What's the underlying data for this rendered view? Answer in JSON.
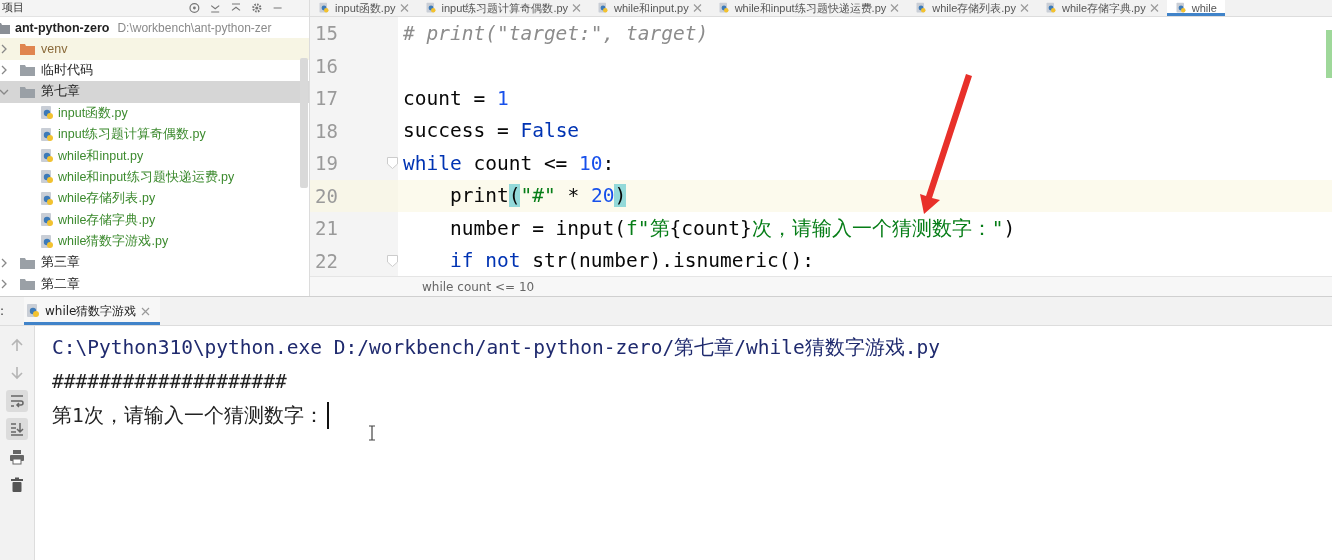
{
  "sidebar": {
    "title": "项目",
    "tree": [
      {
        "name": "ant-python-zero",
        "path": "D:\\workbench\\ant-python-zer",
        "kind": "root",
        "selected": false,
        "children": [
          {
            "name": "venv",
            "kind": "excluded",
            "expanded": false,
            "selected": false
          },
          {
            "name": "临时代码",
            "kind": "folder",
            "expanded": false,
            "selected": false
          },
          {
            "name": "第七章",
            "kind": "folder",
            "expanded": true,
            "selected": true,
            "children": [
              {
                "name": "input函数.py",
                "kind": "file",
                "selected": false
              },
              {
                "name": "input练习题计算奇偶数.py",
                "kind": "file",
                "selected": false
              },
              {
                "name": "while和input.py",
                "kind": "file",
                "selected": false
              },
              {
                "name": "while和input练习题快递运费.py",
                "kind": "file",
                "selected": false
              },
              {
                "name": "while存储列表.py",
                "kind": "file",
                "selected": false
              },
              {
                "name": "while存储字典.py",
                "kind": "file",
                "selected": false
              },
              {
                "name": "while猜数字游戏.py",
                "kind": "file",
                "selected": false
              }
            ]
          },
          {
            "name": "第三章",
            "kind": "folder",
            "expanded": false,
            "selected": false
          },
          {
            "name": "第二章",
            "kind": "folder",
            "expanded": false,
            "selected": false
          }
        ]
      }
    ]
  },
  "editor": {
    "tabs": [
      {
        "label": "input函数.py",
        "selected": false
      },
      {
        "label": "input练习题计算奇偶数.py",
        "selected": false
      },
      {
        "label": "while和input.py",
        "selected": false
      },
      {
        "label": "while和input练习题快递运费.py",
        "selected": false
      },
      {
        "label": "while存储列表.py",
        "selected": false
      },
      {
        "label": "while存储字典.py",
        "selected": false
      },
      {
        "label": "while",
        "selected": true
      }
    ],
    "lines": [
      {
        "number": "15",
        "current": false,
        "foldable": false,
        "tokens": [
          {
            "kind": "comment",
            "text": "# print(\"target:\", target)"
          }
        ]
      },
      {
        "number": "16",
        "current": false,
        "foldable": false
      },
      {
        "number": "17",
        "current": false,
        "foldable": false,
        "tokens": [
          {
            "kind": "plain",
            "text": "count = "
          },
          {
            "kind": "number",
            "text": "1"
          }
        ]
      },
      {
        "number": "18",
        "current": false,
        "foldable": false,
        "tokens": [
          {
            "kind": "plain",
            "text": "success = "
          },
          {
            "kind": "keyword",
            "text": "False"
          }
        ]
      },
      {
        "number": "19",
        "current": false,
        "foldable": true,
        "tokens": [
          {
            "kind": "keyword",
            "text": "while"
          },
          {
            "kind": "plain",
            "text": " count <= "
          },
          {
            "kind": "number",
            "text": "10"
          },
          {
            "kind": "plain",
            "text": ":"
          }
        ]
      },
      {
        "number": "20",
        "current": true,
        "foldable": false,
        "tokens": [
          {
            "kind": "plain",
            "text": "    print"
          },
          {
            "kind": "brace",
            "text": "("
          },
          {
            "kind": "string",
            "text": "\"#\""
          },
          {
            "kind": "plain",
            "text": " * "
          },
          {
            "kind": "number",
            "text": "20"
          },
          {
            "kind": "brace",
            "text": ")"
          }
        ]
      },
      {
        "number": "21",
        "current": false,
        "foldable": false,
        "tokens": [
          {
            "kind": "plain",
            "text": "    number = input("
          },
          {
            "kind": "string",
            "text": "f\"第"
          },
          {
            "kind": "plain",
            "text": "{count}"
          },
          {
            "kind": "string",
            "text": "次，请输入一个猜测数字：\""
          },
          {
            "kind": "plain",
            "text": ")"
          }
        ]
      },
      {
        "number": "22",
        "current": false,
        "foldable": true,
        "tokens": [
          {
            "kind": "keyword",
            "text": "    if not"
          },
          {
            "kind": "plain",
            "text": " str(number).isnumeric():"
          }
        ]
      }
    ],
    "breadcrumb": "while count <= 10"
  },
  "run_panel": {
    "label": ":",
    "tabs": [
      {
        "label": "while猜数字游戏",
        "selected": true
      }
    ],
    "toolbar": [
      {
        "kind": "up",
        "active": false
      },
      {
        "kind": "down",
        "active": false
      },
      {
        "kind": "wrap",
        "active": true
      },
      {
        "kind": "scroll-end",
        "active": true
      },
      {
        "kind": "print",
        "active": false
      },
      {
        "kind": "trash",
        "active": false
      }
    ],
    "output": [
      {
        "kind": "command",
        "text": "C:\\Python310\\python.exe D:/workbench/ant-python-zero/第七章/while猜数字游戏.py",
        "caret": false
      },
      {
        "kind": "stdout",
        "text": "####################",
        "caret": false
      },
      {
        "kind": "stdout",
        "text": "第1次，请输入一个猜测数字：",
        "caret": true
      }
    ]
  }
}
